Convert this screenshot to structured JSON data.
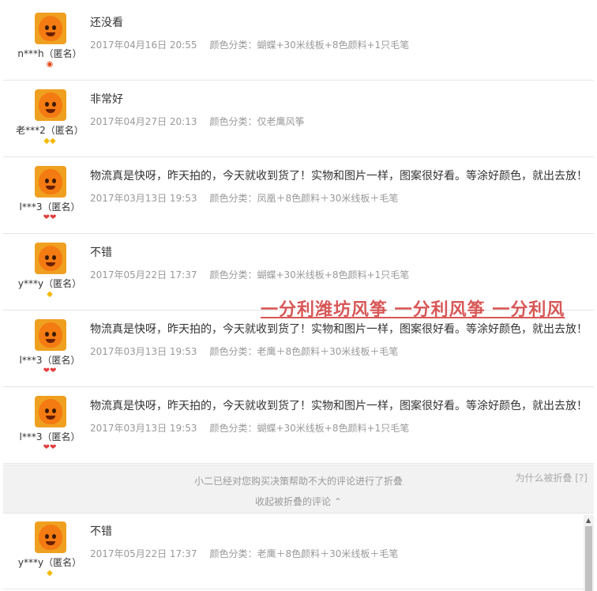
{
  "reviews": [
    {
      "username": "n***h（匿名）",
      "badge": "crown",
      "text": "还没看",
      "date": "2017年04月16日 20:55",
      "sku": "颜色分类：蝴蝶+30米线板+8色颜料+1只毛笔"
    },
    {
      "username": "老***2（匿名）",
      "badge": "gold2",
      "text": "非常好",
      "date": "2017年04月27日 20:13",
      "sku": "颜色分类：仅老鹰风筝"
    },
    {
      "username": "l***3（匿名）",
      "badge": "red2",
      "text": "物流真是快呀，昨天拍的，今天就收到货了！实物和图片一样，图案很好看。等涂好颜色，就出去放！",
      "date": "2017年03月13日 19:53",
      "sku": "颜色分类：凤凰＋8色颜料＋30米线板＋毛笔"
    },
    {
      "username": "y***y（匿名）",
      "badge": "gold1",
      "text": "不错",
      "date": "2017年05月22日 17:37",
      "sku": "颜色分类：蝴蝶+30米线板+8色颜料+1只毛笔"
    },
    {
      "username": "l***3（匿名）",
      "badge": "red2",
      "text": "物流真是快呀，昨天拍的，今天就收到货了！实物和图片一样，图案很好看。等涂好颜色，就出去放！",
      "date": "2017年03月13日 19:53",
      "sku": "颜色分类：老鹰＋8色颜料＋30米线板＋毛笔"
    },
    {
      "username": "l***3（匿名）",
      "badge": "red2",
      "text": "物流真是快呀，昨天拍的，今天就收到货了！实物和图片一样，图案很好看。等涂好颜色，就出去放！",
      "date": "2017年03月13日 19:53",
      "sku": "颜色分类：蝴蝶+30米线板+8色颜料+1只毛笔"
    }
  ],
  "watermark": "一分利潍坊风筝 一分利风筝 一分利风",
  "folded": {
    "notice": "小二已经对您购买决策帮助不大的评论进行了折叠",
    "collapse_label": "收起被折叠的评论",
    "why_label": "为什么被折叠 [?]"
  },
  "folded_reviews": [
    {
      "username": "y***y（匿名）",
      "badge": "gold1",
      "text": "不错",
      "date": "2017年05月22日 17:37",
      "sku": "颜色分类：老鹰＋8色颜料＋30米线板＋毛笔"
    }
  ],
  "icons": {
    "avatar": "mascot-avatar-icon",
    "collapse": "chevron-up-icon",
    "scroll_up": "triangle-up-icon"
  }
}
